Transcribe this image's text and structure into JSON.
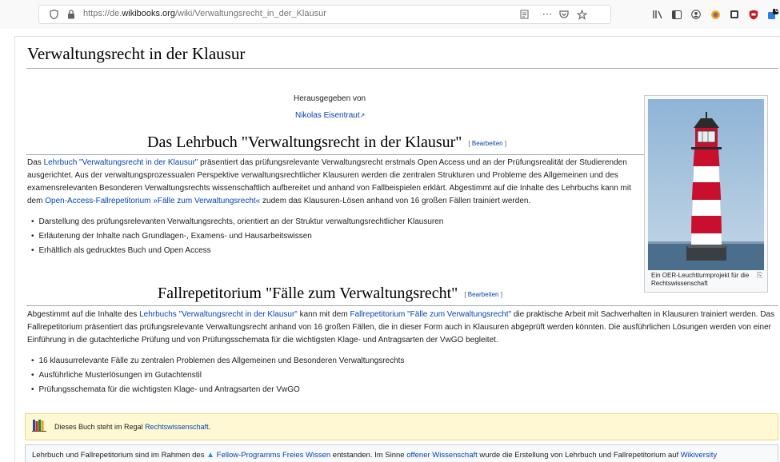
{
  "browser": {
    "url_prefix": "https://de.",
    "url_domain": "wikibooks.org",
    "url_path": "/wiki/Verwaltungsrecht_in_der_Klausur",
    "notification_count": "0"
  },
  "page": {
    "title": "Verwaltungsrecht in der Klausur",
    "published_by": "Herausgegeben von",
    "editor": "Nikolas Eisentraut"
  },
  "section1": {
    "heading": "Das Lehrbuch \"Verwaltungsrecht in der Klausur\"",
    "edit_open": "[ ",
    "edit_label": "Bearbeiten",
    "edit_close": " ]",
    "para_1": "Das ",
    "para_link1": "Lehrbuch \"Verwaltungsrecht in der Klausur\"",
    "para_2": " präsentiert das prüfungsrelevante Verwaltungsrecht erstmals Open Access und an der Prüfungsrealität der Studierenden ausgerichtet. Aus der verwaltungsprozessualen Perspektive verwaltungsrechtlicher Klausuren werden die zentralen Strukturen und Probleme des Allgemeinen und des examensrelevanten Besonderen Verwaltungsrechts wissenschaftlich aufbereitet und anhand von Fallbeispielen erklärt. Abgestimmt auf die Inhalte des Lehrbuchs kann mit dem ",
    "para_link2": "Open-Access-Fallrepetitorium »Fälle zum Verwaltungsrecht«",
    "para_3": " zudem das Klausuren-Lösen anhand von 16 großen Fällen trainiert werden.",
    "bullets": [
      "Darstellung des prüfungsrelevanten Verwaltungsrechts, orientiert an der Struktur verwaltungsrechtlicher Klausuren",
      "Erläuterung der Inhalte nach Grundlagen-, Examens- und Hausarbeitswissen",
      "Erhältlich als gedrucktes Buch und Open Access"
    ]
  },
  "section2": {
    "heading": "Fallrepetitorium \"Fälle zum Verwaltungsrecht\"",
    "edit_open": "[ ",
    "edit_label": "Bearbeiten",
    "edit_close": " ]",
    "para_1": "Abgestimmt auf die Inhalte des ",
    "para_link1": "Lehrbuchs \"Verwaltungsrecht in der Klausur\"",
    "para_2": " kann mit dem ",
    "para_link2": "Fallrepetitorium \"Fälle zum Verwaltungsrecht\"",
    "para_3": " die praktische Arbeit mit Sachverhalten in Klausuren trainiert werden. Das Fallrepetitorium präsentiert das prüfungsrelevante Verwaltungsrecht anhand von 16 großen Fällen, die in dieser Form auch in Klausuren abgeprüft werden könnten. Die ausführlichen Lösungen werden von einer Einführung in die gutachterliche Prüfung und von Prüfungsschemata für die wichtigsten Klage- und Antragsarten der VwGO begleitet.",
    "bullets": [
      "16 klausurrelevante Fälle zu zentralen Problemen des Allgemeinen und Besonderen Verwaltungsrechts",
      "Ausführliche Musterlösungen im Gutachtenstil",
      "Prüfungsschemata für die wichtigsten Klage- und Antragsarten der VwGO"
    ]
  },
  "thumbnail": {
    "caption": "Ein OER-Leuchtturmprojekt für die Rechtswissenschaft"
  },
  "shelf": {
    "text": "Dieses Buch steht im Regal ",
    "link": "Rechtswissenschaft",
    "end": "."
  },
  "footer": {
    "text_1": "Lehrbuch und Fallrepetitorium sind im Rahmen des ",
    "link_1": "Fellow-Programms Freies Wissen",
    "text_2": " entstanden. Im Sinne ",
    "link_2": "offener Wissenschaft",
    "text_3": " wurde die Erstellung von Lehrbuch und Fallrepetitorium auf ",
    "link_3": "Wikiversity"
  },
  "colors": {
    "link": "#0645ad",
    "shelf_bg": "#fff8d2",
    "lighthouse_red": "#c8102e"
  }
}
